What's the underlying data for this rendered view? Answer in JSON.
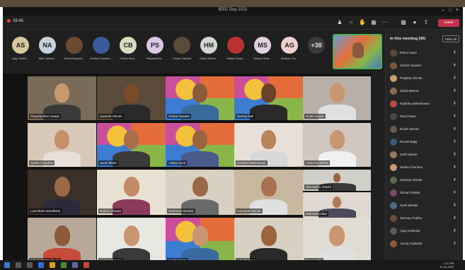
{
  "window": {
    "title": "IEEE Day 2021"
  },
  "toolbar": {
    "elapsed": "39:45",
    "leave_label": "Leave"
  },
  "avatar_strip": [
    {
      "initials": "AS",
      "name": "Ajay Shanb...",
      "color": "#d8c8a0"
    },
    {
      "initials": "NA",
      "name": "Nitin Jaiswa...",
      "color": "#c7d2dc"
    },
    {
      "initials": "",
      "name": "Roma Mayand...",
      "color": "#6b4a32"
    },
    {
      "initials": "",
      "name": "Sunita Chauhan...",
      "color": "#3a5a9c"
    },
    {
      "initials": "CB",
      "name": "Chetna Bha...",
      "color": "#d6ddc0"
    },
    {
      "initials": "PS",
      "name": "Priyadarsha...",
      "color": "#d9c8e8"
    },
    {
      "initials": "",
      "name": "Omkar Sawant",
      "color": "#5a4a3a"
    },
    {
      "initials": "HM",
      "name": "Harsh Mehta...",
      "color": "#d0d8d0"
    },
    {
      "initials": "",
      "name": "Aditya Sawa...",
      "color": "#b83232"
    },
    {
      "initials": "MS",
      "name": "Mohan Shar...",
      "color": "#e0d0e0"
    },
    {
      "initials": "AG",
      "name": "Abhinav Gu...",
      "color": "#f0d0d0"
    },
    {
      "initials": "+38",
      "name": "",
      "color": "#3a3a3a"
    }
  ],
  "tiles": [
    {
      "name": "Priyadarshini Swarjit",
      "bg": "#7a6a58",
      "skin": "#c89870",
      "shirt": "#3a3a3a",
      "ieee": false
    },
    {
      "name": "Santosh Shinde",
      "bg": "#5a4a3a",
      "skin": "#7a4a2a",
      "shirt": "#2a2a2a",
      "ieee": false
    },
    {
      "name": "Omkar Sawant",
      "bg": "",
      "skin": "#8a5a3a",
      "shirt": "#3a6a9a",
      "ieee": true
    },
    {
      "name": "Neeraj Patil",
      "bg": "",
      "skin": "#6a4228",
      "shirt": "#2a2a2a",
      "ieee": true
    },
    {
      "name": "Rushi Pawar",
      "bg": "#b8b0a8",
      "skin": "#c89670",
      "shirt": "#e0e0e0",
      "ieee": false
    },
    {
      "name": "Sarika Chauhan",
      "bg": "#d8c8b8",
      "skin": "#c8906a",
      "shirt": "#e8e0d8",
      "ieee": false
    },
    {
      "name": "Sarvil Bhide",
      "bg": "",
      "skin": "#a8704a",
      "shirt": "#3a3a3a",
      "ieee": true
    },
    {
      "name": "Aditya Sood",
      "bg": "",
      "skin": "#9a6440",
      "shirt": "#4a5a8a",
      "ieee": true
    },
    {
      "name": "Kaulast Maheshwari",
      "bg": "#e8e0d8",
      "skin": "#b8845a",
      "shirt": "#d8d8d8",
      "ieee": false
    },
    {
      "name": "Anita Kumbhkar",
      "bg": "#d0c8c0",
      "skin": "#c89670",
      "shirt": "#f0f0f0",
      "ieee": false
    },
    {
      "name": "Laxmikant Mandlekar",
      "bg": "#3a3028",
      "skin": "#9a6a46",
      "shirt": "#2a2a3a",
      "ieee": false
    },
    {
      "name": "Radha Chavan",
      "bg": "#e8e0d0",
      "skin": "#c48a66",
      "shirt": "#8a3a5a",
      "ieee": false
    },
    {
      "name": "Omkumar Bendre",
      "bg": "#d8d0c0",
      "skin": "#9a6a46",
      "shirt": "#6a6a6a",
      "ieee": false
    },
    {
      "name": "Kaivalyah Bende",
      "bg": "#c8b8a0",
      "skin": "#a87250",
      "shirt": "#e0e0e0",
      "ieee": false
    },
    {
      "name": "Shivraddin Shaikh",
      "bg": "#d0d0c8",
      "skin": "#9a6440",
      "shirt": "#3a3a3a",
      "ieee": false
    },
    {
      "name": "Mukund Kelkar",
      "bg": "#e0d8d0",
      "skin": "#b07a54",
      "shirt": "#4a4a5a",
      "ieee": false
    },
    {
      "name": "Ashray Parmeshwar",
      "bg": "#b8a898",
      "skin": "#8a5a3a",
      "shirt": "#c84a3a",
      "ieee": false
    },
    {
      "name": "Varnan Sharma",
      "bg": "#e8e8e0",
      "skin": "#c89670",
      "shirt": "#3a3a3a",
      "ieee": false
    },
    {
      "name": "Harsh Mehta",
      "bg": "",
      "skin": "#c89670",
      "shirt": "#3a6aa0",
      "ieee": true
    },
    {
      "name": "Lokesh Raut",
      "bg": "#d8d0c0",
      "skin": "#9a6440",
      "shirt": "#2a2a2a",
      "ieee": false
    },
    {
      "name": "Gauri Joshi",
      "bg": "#e0dcd4",
      "skin": "#c89670",
      "shirt": "#e0e0e0",
      "ieee": false
    }
  ],
  "panel": {
    "header": "In this meeting (46)",
    "mute_all": "Mute all",
    "people": [
      {
        "name": "Rahul Awari",
        "color": "#5a4a3a"
      },
      {
        "name": "Omkar Sawant",
        "color": "#7a5a3a"
      },
      {
        "name": "Prajakta Shinde",
        "color": "#c8a070"
      },
      {
        "name": "Sahej Manral",
        "color": "#8a6a4a"
      },
      {
        "name": "Radhika Maheshwari",
        "color": "#b84a4a"
      },
      {
        "name": "Ravi Pawar",
        "color": "#4a4a4a"
      },
      {
        "name": "Rutvik Bende",
        "color": "#6a5a4a"
      },
      {
        "name": "Ronak Bajaj",
        "color": "#3a5a7a"
      },
      {
        "name": "Sahil Marwe",
        "color": "#9a7a5a"
      },
      {
        "name": "Sarika Chauhan",
        "color": "#c89a7a"
      },
      {
        "name": "Sankalp Shinde",
        "color": "#5a6a4a"
      },
      {
        "name": "Shivani Kalkar",
        "color": "#7a4a6a"
      },
      {
        "name": "Sneh Bhalait",
        "color": "#4a6a8a"
      },
      {
        "name": "Tanmay Prabhu",
        "color": "#6a4a3a"
      },
      {
        "name": "Vijay Kothekar",
        "color": "#5a5a5a"
      },
      {
        "name": "Yuvraj Gaikwad",
        "color": "#8a5a3a"
      }
    ]
  },
  "taskbar": {
    "time": "1:37 PM",
    "date": "19-10-2021"
  }
}
